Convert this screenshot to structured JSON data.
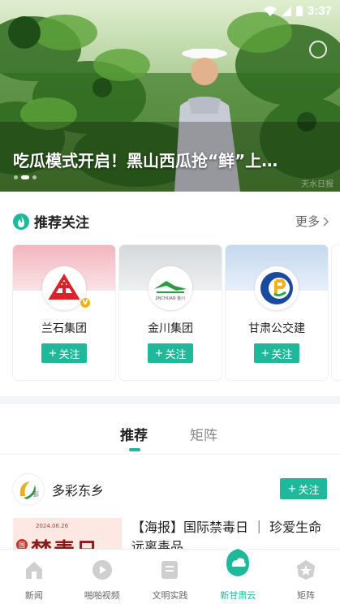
{
  "status_bar": {
    "time": "3:37"
  },
  "hero": {
    "title": "吃瓜模式开启！黑山西瓜抢“鲜”上…",
    "watermark": "天水日报",
    "slide_count": 3,
    "active_slide": 2
  },
  "recommend": {
    "title": "推荐关注",
    "more_label": "更多",
    "cards": [
      {
        "name": "兰石集团",
        "follow_label": "关注",
        "band_color": "#f6c9cf",
        "verified": true,
        "verified_mark": "V"
      },
      {
        "name": "金川集团",
        "follow_label": "关注",
        "band_color": "#d9dcdf",
        "verified": false,
        "logo_text": "JINCHUAN 金川"
      },
      {
        "name": "甘肃公交建",
        "follow_label": "关注",
        "band_color": "#cfe0f2",
        "verified": false
      }
    ]
  },
  "feed": {
    "tabs": [
      {
        "label": "推荐",
        "active": true
      },
      {
        "label": "矩阵",
        "active": false
      }
    ],
    "item": {
      "source_name": "多彩东乡",
      "source_avatar_text": "彭",
      "follow_label": "关注",
      "thumb_date": "2024.06.26",
      "thumb_text": "禁毒日",
      "thumb_badge": "国",
      "headline": "【海报】国际禁毒日 ｜ 珍爱生命 远离毒品"
    }
  },
  "bottom_nav": [
    {
      "label": "新闻",
      "icon": "home-icon",
      "active": false
    },
    {
      "label": "啪啪视频",
      "icon": "play-icon",
      "active": false
    },
    {
      "label": "文明实践",
      "icon": "book-icon",
      "active": false
    },
    {
      "label": "新甘肃云",
      "icon": "cloud-icon",
      "active": true
    },
    {
      "label": "矩阵",
      "icon": "star-badge-icon",
      "active": false
    }
  ],
  "colors": {
    "accent": "#1fb89a"
  }
}
